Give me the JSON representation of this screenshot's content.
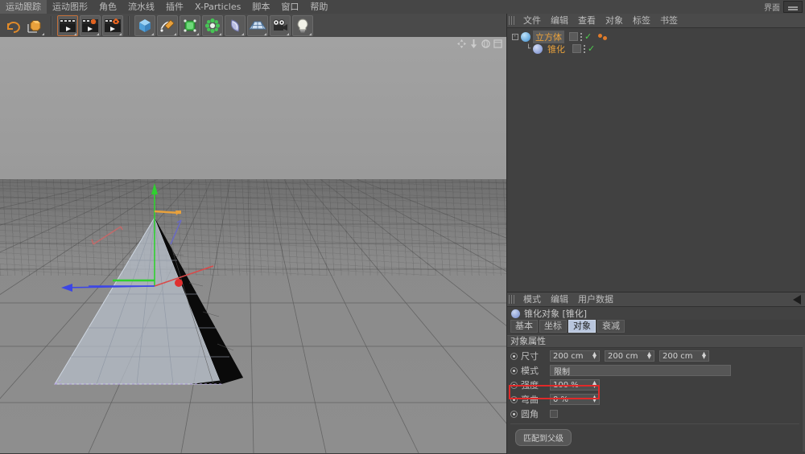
{
  "app": {
    "name": "CINEMA 4D",
    "accent_orange": "#e8a13c",
    "highlight_red": "#e02a2a",
    "panel_bg": "#414141"
  },
  "menubar": {
    "items": [
      {
        "label": "运动跟踪"
      },
      {
        "label": "运动图形"
      },
      {
        "label": "角色"
      },
      {
        "label": "流水线"
      },
      {
        "label": "插件"
      },
      {
        "label": "X-Particles"
      },
      {
        "label": "脚本"
      },
      {
        "label": "窗口"
      },
      {
        "label": "帮助"
      }
    ],
    "layout_label": "界面"
  },
  "toolbar": {
    "groups": [
      {
        "buttons": [
          {
            "name": "undo-redo-button",
            "icon": "undo-icon"
          },
          {
            "name": "move-tool-button",
            "icon": "move-cube-icon"
          }
        ]
      },
      {
        "buttons": [
          {
            "name": "render-view-button",
            "icon": "render-clapper-icon",
            "selected": true
          },
          {
            "name": "render-region-button",
            "icon": "render-region-icon"
          },
          {
            "name": "render-settings-button",
            "icon": "render-settings-gear-icon"
          }
        ]
      },
      {
        "buttons": [
          {
            "name": "add-cube-button",
            "icon": "cube-icon"
          },
          {
            "name": "add-spline-button",
            "icon": "spline-pen-icon"
          },
          {
            "name": "add-nurbs-button",
            "icon": "nurbs-icon"
          },
          {
            "name": "add-array-button",
            "icon": "array-icon"
          },
          {
            "name": "add-deformer-button",
            "icon": "bend-deformer-icon"
          },
          {
            "name": "add-scene-object-button",
            "icon": "floor-icon"
          },
          {
            "name": "add-camera-button",
            "icon": "camera-icon"
          },
          {
            "name": "add-light-button",
            "icon": "light-bulb-icon"
          }
        ]
      }
    ]
  },
  "viewport": {
    "name": "perspective-viewport",
    "nav_icons": [
      "pan-icon",
      "dolly-icon",
      "rotate-icon",
      "maximize-icon"
    ],
    "scene": {
      "object": "tapered-cube-pyramid",
      "axis_gizmo": {
        "x": "#3c46e6",
        "y": "#2fd02f",
        "z": "#d94a4a",
        "center": "#e03030"
      }
    }
  },
  "object_manager": {
    "menu": [
      {
        "label": "文件"
      },
      {
        "label": "编辑"
      },
      {
        "label": "查看"
      },
      {
        "label": "对象"
      },
      {
        "label": "标签"
      },
      {
        "label": "书签"
      }
    ],
    "objects": [
      {
        "name": "立方体",
        "icon_color": "#55a8e8",
        "selected": true,
        "has_tag_dot": true,
        "expander": "-"
      },
      {
        "name": "锥化",
        "icon_color": "#8ba7e0",
        "selected": false,
        "has_tag_dot": false,
        "expander": ""
      }
    ]
  },
  "attribute_manager": {
    "menu": [
      {
        "label": "模式"
      },
      {
        "label": "编辑"
      },
      {
        "label": "用户数据"
      }
    ],
    "object_title": "锥化对象 [锥化]",
    "tabs": [
      {
        "label": "基本",
        "active": false
      },
      {
        "label": "坐标",
        "active": false
      },
      {
        "label": "对象",
        "active": true
      },
      {
        "label": "衰减",
        "active": false
      }
    ],
    "section_title": "对象属性",
    "properties": {
      "size_label": "尺寸",
      "size_x": "200 cm",
      "size_y": "200 cm",
      "size_z": "200 cm",
      "mode_label": "模式",
      "mode_value": "限制",
      "strength_label": "强度",
      "strength_value": "100 %",
      "curvature_label": "弯曲",
      "curvature_value": "0 %",
      "fillet_label": "圆角",
      "match_parent_button": "匹配到父级"
    }
  }
}
